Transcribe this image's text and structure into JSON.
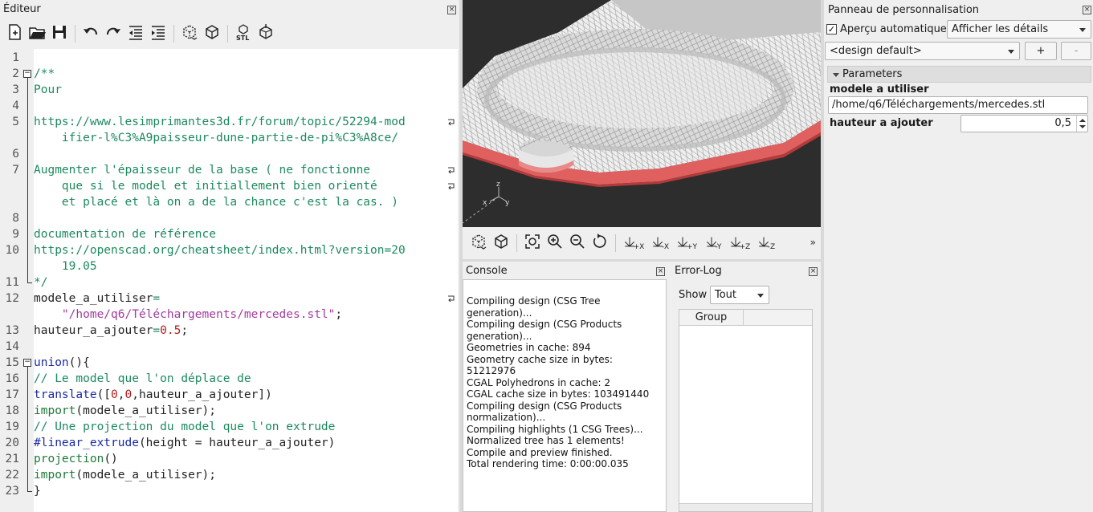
{
  "editor": {
    "title": "Éditeur",
    "close": "×",
    "toolbar": [
      {
        "name": "new-file-icon"
      },
      {
        "name": "open-file-icon"
      },
      {
        "name": "save-file-icon"
      },
      {
        "sep": true
      },
      {
        "name": "undo-icon"
      },
      {
        "name": "redo-icon"
      },
      {
        "name": "unindent-icon"
      },
      {
        "name": "indent-icon"
      },
      {
        "sep": true
      },
      {
        "name": "preview-icon"
      },
      {
        "name": "render-icon"
      },
      {
        "sep": true
      },
      {
        "name": "export-stl-icon",
        "label": "STL"
      },
      {
        "name": "send-to-3d-print-icon"
      }
    ],
    "line_numbers": [
      "1",
      "2",
      "3",
      "4",
      "5",
      "",
      "6",
      "7",
      "",
      "",
      "8",
      "9",
      "10",
      "",
      "11",
      "12",
      "",
      "13",
      "14",
      "15",
      "16",
      "17",
      "18",
      "19",
      "20",
      "21",
      "22",
      "23"
    ],
    "lines": [
      [],
      [
        {
          "c": "com",
          "t": "/**"
        }
      ],
      [
        {
          "c": "com",
          "t": "Pour"
        }
      ],
      [],
      [
        {
          "c": "com",
          "t": "https://www.lesimprimantes3d.fr/forum/topic/52294-mod"
        }
      ],
      [
        {
          "c": "com",
          "t": "    ifier-l%C3%A9paisseur-dune-partie-de-pi%C3%A8ce/"
        }
      ],
      [],
      [
        {
          "c": "com",
          "t": "Augmenter l'épaisseur de la base ( ne fonctionne"
        }
      ],
      [
        {
          "c": "com",
          "t": "    que si le model et initiallement bien orienté"
        }
      ],
      [
        {
          "c": "com",
          "t": "    et placé et là on a de la chance c'est la cas. )"
        }
      ],
      [],
      [
        {
          "c": "com",
          "t": "documentation de référence"
        }
      ],
      [
        {
          "c": "com",
          "t": "https://openscad.org/cheatsheet/index.html?version=20"
        }
      ],
      [
        {
          "c": "com",
          "t": "    19.05"
        }
      ],
      [
        {
          "c": "com",
          "t": "*/"
        }
      ],
      [
        {
          "c": "id",
          "t": "modele_a_utiliser"
        },
        {
          "c": "com",
          "t": "="
        }
      ],
      [
        {
          "c": "id",
          "t": "    "
        },
        {
          "c": "str",
          "t": "\"/home/q6/Téléchargements/mercedes.stl\""
        },
        {
          "c": "id",
          "t": ";"
        }
      ],
      [
        {
          "c": "id",
          "t": "hauteur_a_ajouter"
        },
        {
          "c": "com",
          "t": "="
        },
        {
          "c": "num",
          "t": "0.5"
        },
        {
          "c": "id",
          "t": ";"
        }
      ],
      [],
      [
        {
          "c": "kw",
          "t": "union"
        },
        {
          "c": "id",
          "t": "(){"
        }
      ],
      [
        {
          "c": "com",
          "t": "// Le model que l'on déplace de"
        }
      ],
      [
        {
          "c": "kw",
          "t": "translate"
        },
        {
          "c": "id",
          "t": "(["
        },
        {
          "c": "num",
          "t": "0"
        },
        {
          "c": "id",
          "t": ","
        },
        {
          "c": "num",
          "t": "0"
        },
        {
          "c": "id",
          "t": ",hauteur_a_ajouter])"
        }
      ],
      [
        {
          "c": "fn",
          "t": "import"
        },
        {
          "c": "id",
          "t": "(modele_a_utiliser);"
        }
      ],
      [
        {
          "c": "com",
          "t": "// Une projection du model que l'on extrude"
        }
      ],
      [
        {
          "c": "kw",
          "t": "#linear_extrude"
        },
        {
          "c": "id",
          "t": "(height = hauteur_a_ajouter)"
        }
      ],
      [
        {
          "c": "fn",
          "t": "projection"
        },
        {
          "c": "id",
          "t": "()"
        }
      ],
      [
        {
          "c": "fn",
          "t": "import"
        },
        {
          "c": "id",
          "t": "(modele_a_utiliser);"
        }
      ],
      [
        {
          "c": "id",
          "t": "}"
        }
      ]
    ],
    "fold_markers": [
      "−",
      "−"
    ]
  },
  "viewport": {
    "axis_labels": {
      "x": "x",
      "y": "y",
      "z": "z"
    },
    "toolbar_primary": [
      {
        "name": "preview-icon"
      },
      {
        "name": "render-icon"
      }
    ],
    "toolbar_view": [
      {
        "name": "view-all-icon"
      },
      {
        "name": "zoom-in-icon"
      },
      {
        "name": "zoom-out-icon"
      },
      {
        "name": "reset-view-icon"
      }
    ],
    "toolbar_axes": [
      {
        "name": "view-right-icon",
        "label": "+X"
      },
      {
        "name": "view-left-icon",
        "label": "-X"
      },
      {
        "name": "view-back-icon",
        "label": "+Y"
      },
      {
        "name": "view-front-icon",
        "label": "-Y"
      },
      {
        "name": "view-top-icon",
        "label": "+Z"
      },
      {
        "name": "view-bottom-icon",
        "label": "-Z"
      }
    ],
    "more": "»"
  },
  "console": {
    "title": "Console",
    "close": "×",
    "messages": [
      "Compiling design (CSG Tree generation)...",
      "Compiling design (CSG Products generation)...",
      "Geometries in cache: 894",
      "Geometry cache size in bytes: 51212976",
      "CGAL Polyhedrons in cache: 2",
      "CGAL cache size in bytes: 103491440",
      "Compiling design (CSG Products normalization)...",
      "Compiling highlights (1 CSG Trees)...",
      "Normalized tree has 1 elements!",
      "Compile and preview finished.",
      "Total rendering time: 0:00:00.035"
    ]
  },
  "errorlog": {
    "title": "Error-Log",
    "close": "×",
    "show_label": "Show",
    "show_value": "Tout",
    "column_group": "Group"
  },
  "customizer": {
    "title": "Panneau de personnalisation",
    "close": "×",
    "auto_preview_label": "Aperçu automatique",
    "auto_preview_checked": "✓",
    "details_select": "Afficher les détails",
    "design_select": "<design default>",
    "add_button": "+",
    "remove_button": "-",
    "group_title": "Parameters",
    "params": [
      {
        "label": "modele a utiliser",
        "value": "/home/q6/Téléchargements/mercedes.stl"
      },
      {
        "label": "hauteur a ajouter",
        "value": "0,5"
      }
    ]
  }
}
